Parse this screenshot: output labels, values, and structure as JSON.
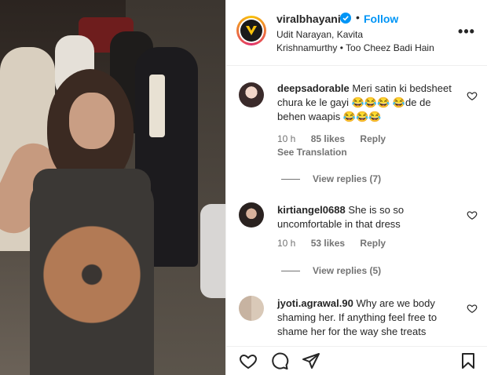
{
  "post": {
    "username": "viralbhayani",
    "dot": "•",
    "follow_label": "Follow",
    "subtitle_line1": "Udit Narayan, Kavita",
    "subtitle_line2": "Krishnamurthy • Too Cheez Badi Hain",
    "more_label": "•••"
  },
  "comments": [
    {
      "username": "deepsadorable",
      "text": "Meri satin ki bedsheet chura ke le gayi 😂😂😂 😂de de behen waapis 😂😂😂",
      "time": "10 h",
      "likes": "85 likes",
      "reply": "Reply",
      "translation": "See Translation",
      "view_replies": "View replies (7)"
    },
    {
      "username": "kirtiangel0688",
      "text": "She is so so uncomfortable in that dress",
      "time": "10 h",
      "likes": "53 likes",
      "reply": "Reply",
      "view_replies": "View replies (5)"
    },
    {
      "username": "jyoti.agrawal.90",
      "text": "Why are we body shaming her. If anything feel free to shame her for the way she treats"
    }
  ],
  "icons": {
    "like": "heart-icon",
    "comment": "comment-icon",
    "share": "paper-plane-icon",
    "save": "bookmark-icon",
    "more": "more-options-icon",
    "verified": "verified-badge-icon"
  },
  "colors": {
    "accent": "#0095f6",
    "text": "#262626",
    "muted": "#737373"
  }
}
